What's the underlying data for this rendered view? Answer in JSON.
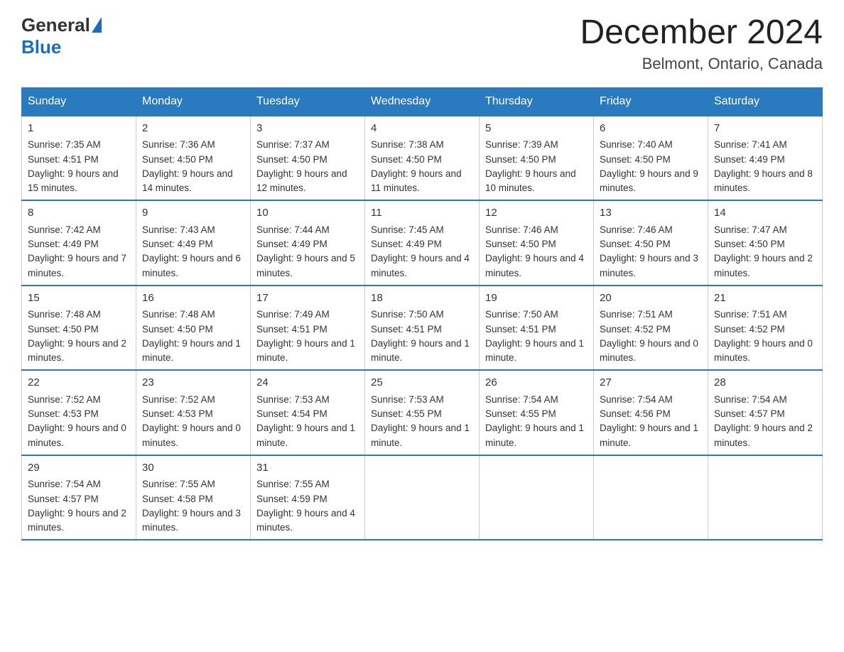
{
  "header": {
    "logo": {
      "general": "General",
      "blue": "Blue"
    },
    "title": "December 2024",
    "location": "Belmont, Ontario, Canada"
  },
  "days_of_week": [
    "Sunday",
    "Monday",
    "Tuesday",
    "Wednesday",
    "Thursday",
    "Friday",
    "Saturday"
  ],
  "weeks": [
    [
      {
        "day": "1",
        "sunrise": "7:35 AM",
        "sunset": "4:51 PM",
        "daylight": "9 hours and 15 minutes."
      },
      {
        "day": "2",
        "sunrise": "7:36 AM",
        "sunset": "4:50 PM",
        "daylight": "9 hours and 14 minutes."
      },
      {
        "day": "3",
        "sunrise": "7:37 AM",
        "sunset": "4:50 PM",
        "daylight": "9 hours and 12 minutes."
      },
      {
        "day": "4",
        "sunrise": "7:38 AM",
        "sunset": "4:50 PM",
        "daylight": "9 hours and 11 minutes."
      },
      {
        "day": "5",
        "sunrise": "7:39 AM",
        "sunset": "4:50 PM",
        "daylight": "9 hours and 10 minutes."
      },
      {
        "day": "6",
        "sunrise": "7:40 AM",
        "sunset": "4:50 PM",
        "daylight": "9 hours and 9 minutes."
      },
      {
        "day": "7",
        "sunrise": "7:41 AM",
        "sunset": "4:49 PM",
        "daylight": "9 hours and 8 minutes."
      }
    ],
    [
      {
        "day": "8",
        "sunrise": "7:42 AM",
        "sunset": "4:49 PM",
        "daylight": "9 hours and 7 minutes."
      },
      {
        "day": "9",
        "sunrise": "7:43 AM",
        "sunset": "4:49 PM",
        "daylight": "9 hours and 6 minutes."
      },
      {
        "day": "10",
        "sunrise": "7:44 AM",
        "sunset": "4:49 PM",
        "daylight": "9 hours and 5 minutes."
      },
      {
        "day": "11",
        "sunrise": "7:45 AM",
        "sunset": "4:49 PM",
        "daylight": "9 hours and 4 minutes."
      },
      {
        "day": "12",
        "sunrise": "7:46 AM",
        "sunset": "4:50 PM",
        "daylight": "9 hours and 4 minutes."
      },
      {
        "day": "13",
        "sunrise": "7:46 AM",
        "sunset": "4:50 PM",
        "daylight": "9 hours and 3 minutes."
      },
      {
        "day": "14",
        "sunrise": "7:47 AM",
        "sunset": "4:50 PM",
        "daylight": "9 hours and 2 minutes."
      }
    ],
    [
      {
        "day": "15",
        "sunrise": "7:48 AM",
        "sunset": "4:50 PM",
        "daylight": "9 hours and 2 minutes."
      },
      {
        "day": "16",
        "sunrise": "7:48 AM",
        "sunset": "4:50 PM",
        "daylight": "9 hours and 1 minute."
      },
      {
        "day": "17",
        "sunrise": "7:49 AM",
        "sunset": "4:51 PM",
        "daylight": "9 hours and 1 minute."
      },
      {
        "day": "18",
        "sunrise": "7:50 AM",
        "sunset": "4:51 PM",
        "daylight": "9 hours and 1 minute."
      },
      {
        "day": "19",
        "sunrise": "7:50 AM",
        "sunset": "4:51 PM",
        "daylight": "9 hours and 1 minute."
      },
      {
        "day": "20",
        "sunrise": "7:51 AM",
        "sunset": "4:52 PM",
        "daylight": "9 hours and 0 minutes."
      },
      {
        "day": "21",
        "sunrise": "7:51 AM",
        "sunset": "4:52 PM",
        "daylight": "9 hours and 0 minutes."
      }
    ],
    [
      {
        "day": "22",
        "sunrise": "7:52 AM",
        "sunset": "4:53 PM",
        "daylight": "9 hours and 0 minutes."
      },
      {
        "day": "23",
        "sunrise": "7:52 AM",
        "sunset": "4:53 PM",
        "daylight": "9 hours and 0 minutes."
      },
      {
        "day": "24",
        "sunrise": "7:53 AM",
        "sunset": "4:54 PM",
        "daylight": "9 hours and 1 minute."
      },
      {
        "day": "25",
        "sunrise": "7:53 AM",
        "sunset": "4:55 PM",
        "daylight": "9 hours and 1 minute."
      },
      {
        "day": "26",
        "sunrise": "7:54 AM",
        "sunset": "4:55 PM",
        "daylight": "9 hours and 1 minute."
      },
      {
        "day": "27",
        "sunrise": "7:54 AM",
        "sunset": "4:56 PM",
        "daylight": "9 hours and 1 minute."
      },
      {
        "day": "28",
        "sunrise": "7:54 AM",
        "sunset": "4:57 PM",
        "daylight": "9 hours and 2 minutes."
      }
    ],
    [
      {
        "day": "29",
        "sunrise": "7:54 AM",
        "sunset": "4:57 PM",
        "daylight": "9 hours and 2 minutes."
      },
      {
        "day": "30",
        "sunrise": "7:55 AM",
        "sunset": "4:58 PM",
        "daylight": "9 hours and 3 minutes."
      },
      {
        "day": "31",
        "sunrise": "7:55 AM",
        "sunset": "4:59 PM",
        "daylight": "9 hours and 4 minutes."
      },
      null,
      null,
      null,
      null
    ]
  ]
}
